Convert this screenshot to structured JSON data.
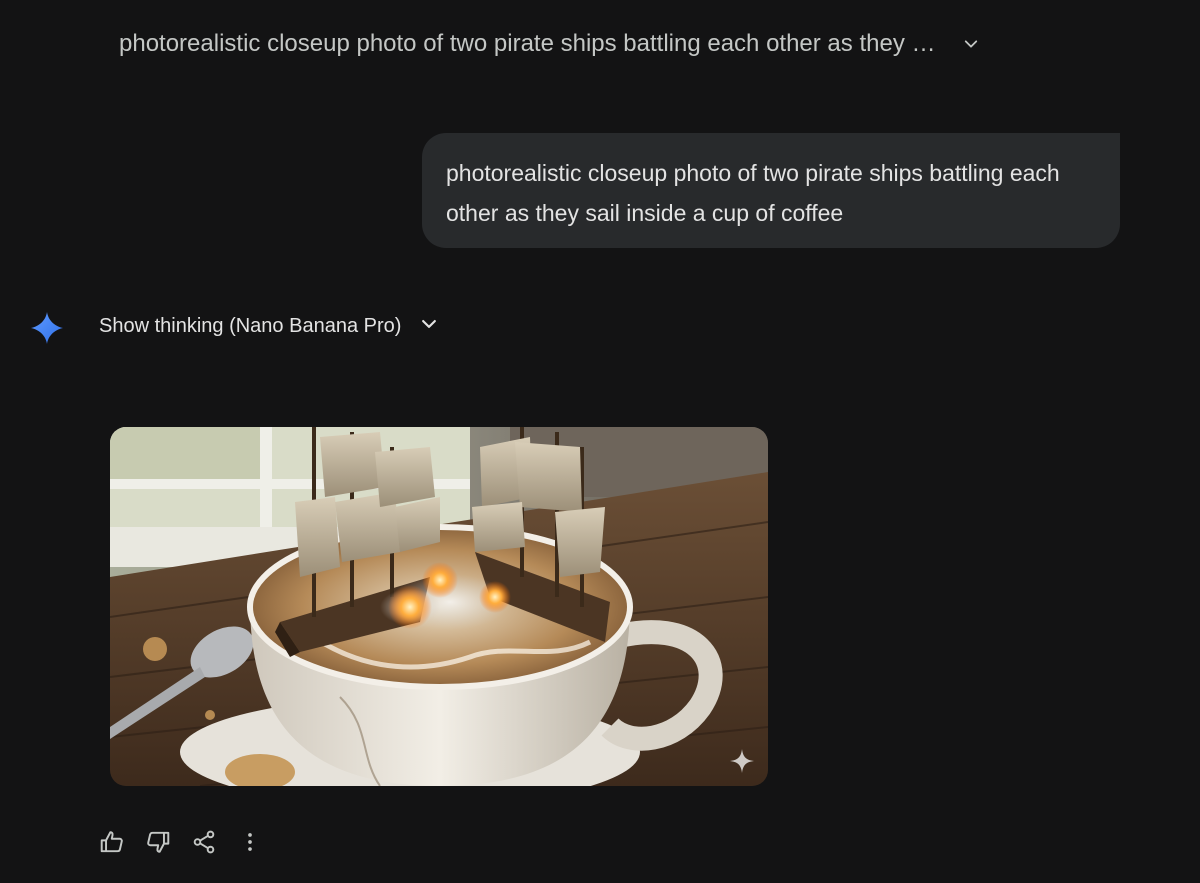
{
  "header": {
    "prompt_title": "photorealistic closeup photo of two pirate ships battling each other as they …",
    "expand_icon": "chevron-down-icon"
  },
  "user_message": {
    "text": "photorealistic closeup photo of two pirate ships battling each other as they sail inside a cup of coffee"
  },
  "response": {
    "avatar_icon": "gemini-spark-icon",
    "thinking_label": "Show thinking (Nano Banana Pro)",
    "thinking_toggle_icon": "chevron-down-icon",
    "image": {
      "alt": "photorealistic closeup photo of two pirate ships battling each other as they sail inside a cup of coffee",
      "watermark_icon": "sparkle-watermark-icon"
    },
    "actions": [
      {
        "name": "thumbs-up-icon"
      },
      {
        "name": "thumbs-down-icon"
      },
      {
        "name": "share-icon"
      },
      {
        "name": "more-vert-icon"
      }
    ]
  },
  "colors": {
    "background": "#131314",
    "bubble": "#282a2c",
    "text_primary": "#e3e3e3",
    "text_secondary": "#c4c7c5",
    "accent_spark": "#4c8df6"
  }
}
